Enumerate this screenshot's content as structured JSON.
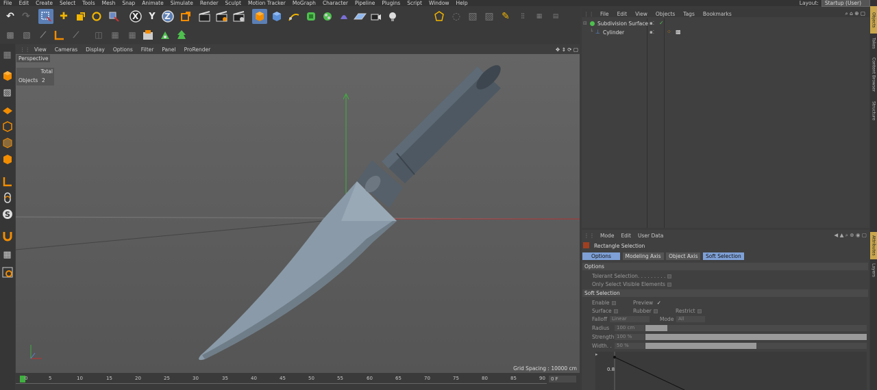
{
  "menubar": {
    "items": [
      "File",
      "Edit",
      "Create",
      "Select",
      "Tools",
      "Mesh",
      "Snap",
      "Animate",
      "Simulate",
      "Render",
      "Sculpt",
      "Motion Tracker",
      "MoGraph",
      "Character",
      "Pipeline",
      "Plugins",
      "Script",
      "Window",
      "Help"
    ],
    "layout_label": "Layout:",
    "layout_value": "Startup (User)"
  },
  "toolbar": {
    "axis_x": "X",
    "axis_y": "Y",
    "axis_z": "Z"
  },
  "viewport": {
    "menu": [
      "View",
      "Cameras",
      "Display",
      "Options",
      "Filter",
      "Panel",
      "ProRender"
    ],
    "label": "Perspective",
    "stats_header": "Total",
    "stats_objects_label": "Objects",
    "stats_objects_value": "2",
    "grid_spacing": "Grid Spacing : 10000 cm"
  },
  "timeline": {
    "ticks": [
      "0",
      "5",
      "10",
      "15",
      "20",
      "25",
      "30",
      "35",
      "40",
      "45",
      "50",
      "55",
      "60",
      "65",
      "70",
      "75",
      "80",
      "85",
      "90"
    ],
    "frame_field": "0 F"
  },
  "object_manager": {
    "menu": [
      "File",
      "Edit",
      "View",
      "Objects",
      "Tags",
      "Bookmarks"
    ],
    "objects": [
      {
        "name": "Subdivision Surface"
      },
      {
        "name": "Cylinder"
      }
    ]
  },
  "attributes": {
    "menu": [
      "Mode",
      "Edit",
      "User Data"
    ],
    "tool_name": "Rectangle Selection",
    "tabs": [
      "Options",
      "Modeling Axis",
      "Object Axis",
      "Soft Selection"
    ],
    "options_header": "Options",
    "tolerant_selection": "Tolerant Selection. . . . . . . . .",
    "only_visible": "Only Select Visible Elements",
    "soft_header": "Soft Selection",
    "enable": "Enable",
    "preview": "Preview",
    "preview_check": "✓",
    "surface": "Surface",
    "rubber": "Rubber",
    "restrict": "Restrict",
    "falloff_label": "Falloff",
    "falloff_value": "Linear",
    "mode_label": "Mode",
    "mode_value": "All",
    "radius_label": "Radius",
    "radius_value": "100 cm",
    "strength_label": "Strength",
    "strength_value": "100 %",
    "width_label": "Width. .",
    "width_value": "50 %",
    "graph_tick": "0.8",
    "radius_fill": 0.1,
    "strength_fill": 1.0,
    "width_fill": 0.5
  },
  "side_tabs": [
    "Objects",
    "Takes",
    "Content Browser",
    "Structure",
    "Attributes",
    "Layers"
  ]
}
